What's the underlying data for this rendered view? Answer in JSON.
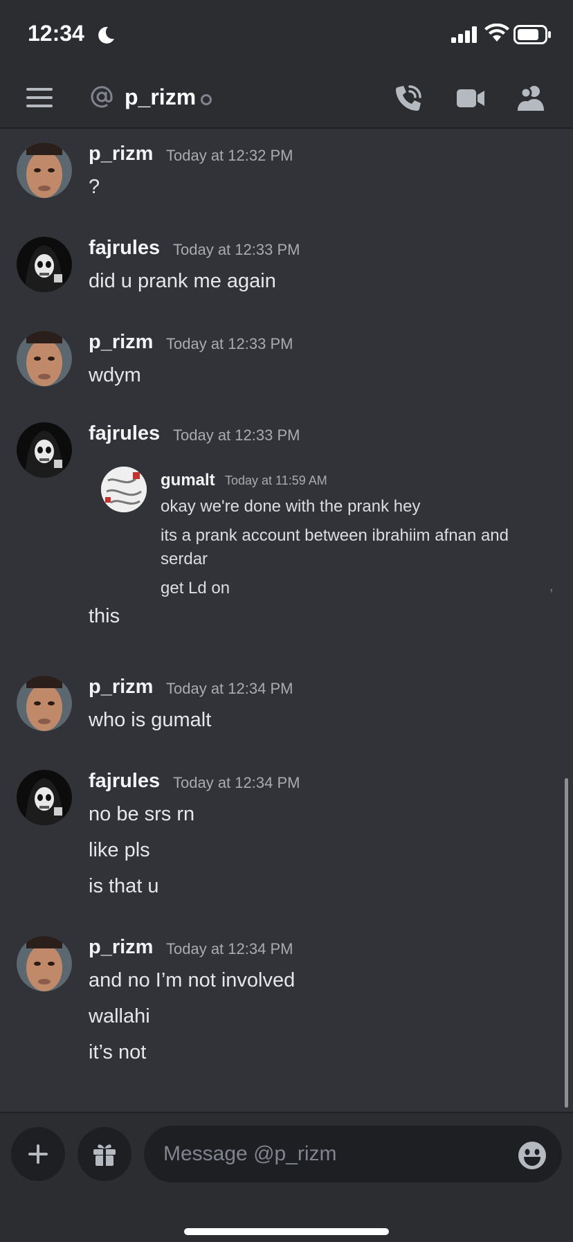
{
  "status_bar": {
    "time": "12:34"
  },
  "header": {
    "title": "p_rizm",
    "at_symbol": "@"
  },
  "messages": [
    {
      "user": "p_rizm",
      "time": "Today at 12:32 PM",
      "lines": [
        "?"
      ]
    },
    {
      "user": "fajrules",
      "time": "Today at 12:33 PM",
      "lines": [
        "did u prank me again"
      ]
    },
    {
      "user": "p_rizm",
      "time": "Today at 12:33 PM",
      "lines": [
        "wdym"
      ]
    },
    {
      "user": "fajrules",
      "time": "Today at 12:33 PM",
      "lines": [
        "this"
      ],
      "forward": {
        "user": "gumalt",
        "time": "Today at 11:59 AM",
        "lines": [
          "okay we're done with the prank hey",
          "its a prank account between ibrahiim afnan and",
          "serdar",
          "get Ld on"
        ]
      }
    },
    {
      "user": "p_rizm",
      "time": "Today at 12:34 PM",
      "lines": [
        "who is gumalt"
      ]
    },
    {
      "user": "fajrules",
      "time": "Today at 12:34 PM",
      "lines": [
        "no be srs rn",
        "like pls",
        "is that u"
      ]
    },
    {
      "user": "p_rizm",
      "time": "Today at 12:34 PM",
      "lines": [
        "and no I’m not involved",
        "wallahi",
        "it’s not"
      ]
    }
  ],
  "composer": {
    "placeholder": "Message @p_rizm"
  },
  "icons": {
    "moon": "moon-icon",
    "signal": "signal-icon",
    "wifi": "wifi-icon",
    "battery": "battery-icon",
    "menu": "menu-icon",
    "call": "call-icon",
    "video": "video-icon",
    "members": "members-icon",
    "add": "plus-icon",
    "gift": "gift-icon",
    "emoji": "emoji-icon"
  },
  "colors": {
    "background": "#313338",
    "header": "#2b2d31",
    "input": "#1e1f22",
    "muted": "#a9abb1"
  }
}
